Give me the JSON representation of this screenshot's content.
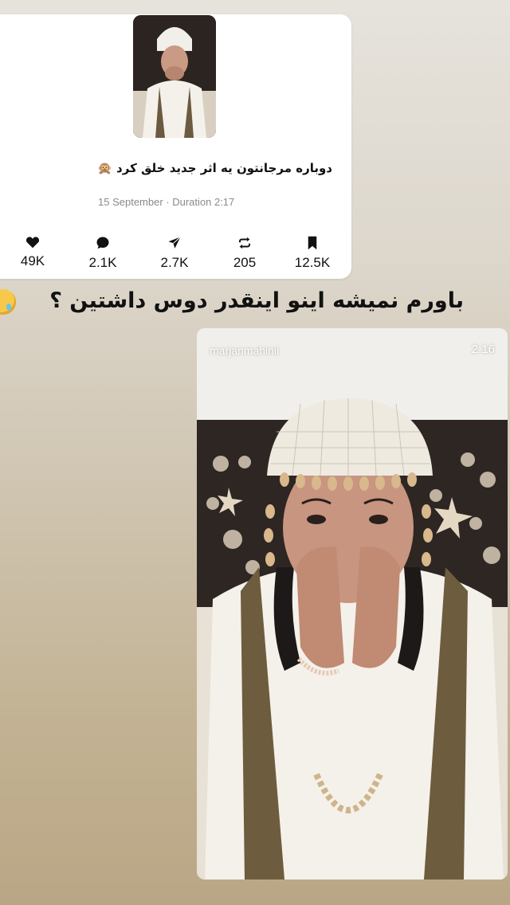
{
  "post_card": {
    "caption": "دوباره مرجانتون یه اثر جدید خلق کرد",
    "caption_emoji": "🙊",
    "meta": "15 September · Duration 2:17",
    "stats": [
      {
        "icon": "heart-icon",
        "value": "49K"
      },
      {
        "icon": "comment-icon",
        "value": "2.1K"
      },
      {
        "icon": "share-icon",
        "value": "2.7K"
      },
      {
        "icon": "repost-icon",
        "value": "205"
      },
      {
        "icon": "bookmark-icon",
        "value": "12.5K"
      }
    ]
  },
  "headline": "باورم نمیشه اینو اینقدر دوس داشتین ؟",
  "headline_emoji_icon": "smiling-face-with-tear-icon",
  "video": {
    "username": "marjanmahinii",
    "duration": "2:16"
  }
}
